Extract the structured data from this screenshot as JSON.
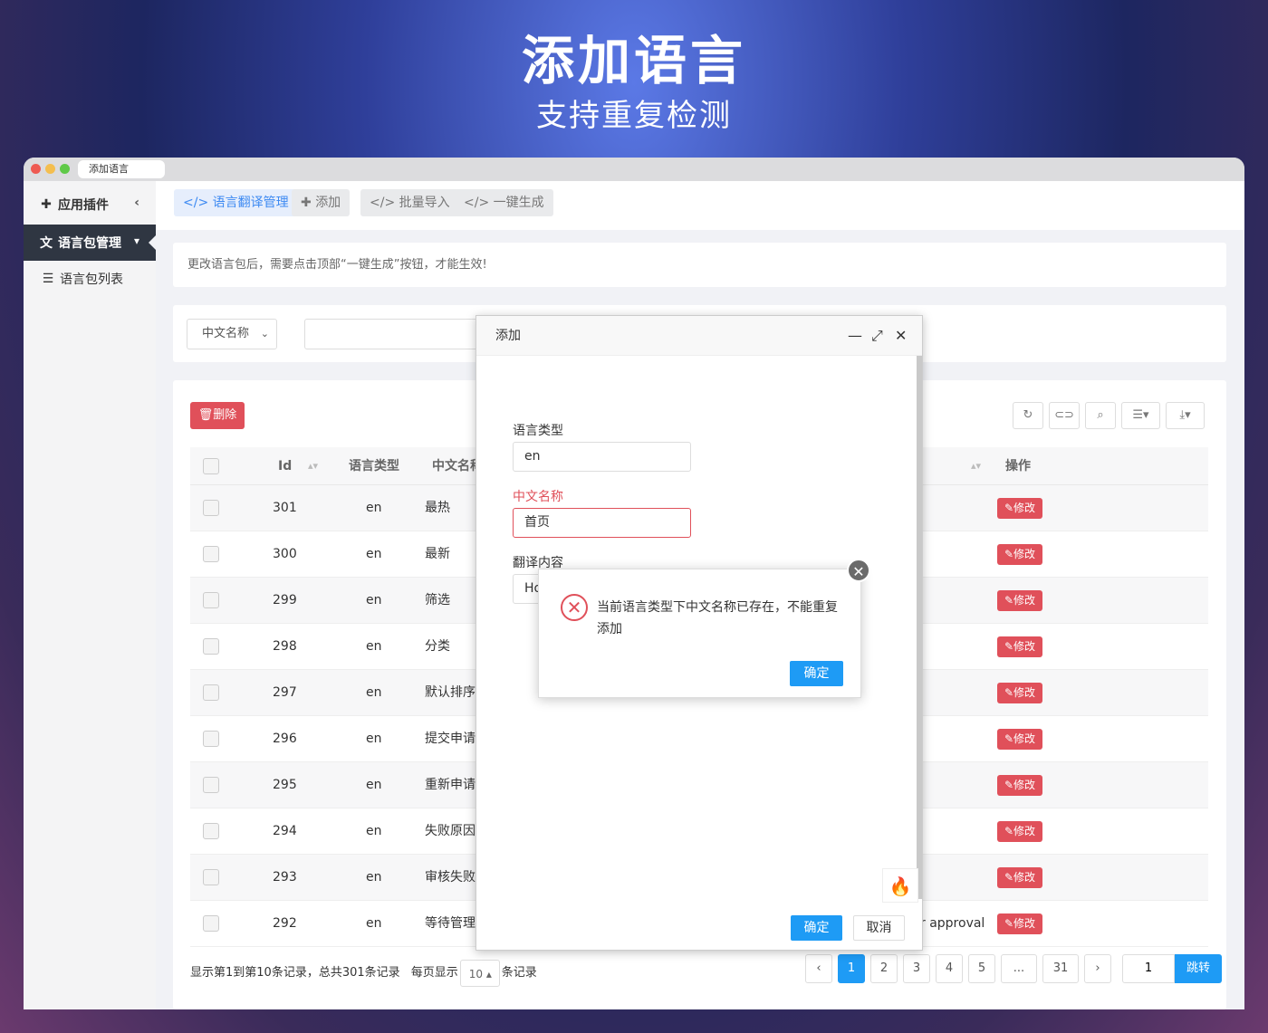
{
  "hero": {
    "title": "添加语言",
    "subtitle": "支持重复检测"
  },
  "window": {
    "tab_title": "添加语言"
  },
  "sidebar": {
    "plugin": "应用插件",
    "lang_manage": "语言包管理",
    "lang_list": "语言包列表"
  },
  "toolbar": {
    "translate_manage": "语言翻译管理",
    "add": "添加",
    "batch_import": "批量导入",
    "one_key": "一键生成"
  },
  "notice": "更改语言包后，需要点击顶部“一键生成”按钮，才能生效!",
  "filter": {
    "field_select": "中文名称"
  },
  "table": {
    "delete_label": "删除",
    "headers": {
      "id": "Id",
      "lang_type": "语言类型",
      "cn_name": "中文名称",
      "op": "操作"
    },
    "edit_label": "修改",
    "rows": [
      {
        "id": "301",
        "type": "en",
        "name": "最热",
        "extra": ""
      },
      {
        "id": "300",
        "type": "en",
        "name": "最新",
        "extra": ""
      },
      {
        "id": "299",
        "type": "en",
        "name": "筛选",
        "extra": ""
      },
      {
        "id": "298",
        "type": "en",
        "name": "分类",
        "extra": ""
      },
      {
        "id": "297",
        "type": "en",
        "name": "默认排序",
        "extra": ""
      },
      {
        "id": "296",
        "type": "en",
        "name": "提交申请",
        "extra": ""
      },
      {
        "id": "295",
        "type": "en",
        "name": "重新申请",
        "extra": ""
      },
      {
        "id": "294",
        "type": "en",
        "name": "失败原因",
        "extra": ""
      },
      {
        "id": "293",
        "type": "en",
        "name": "审核失败",
        "extra": ""
      },
      {
        "id": "292",
        "type": "en",
        "name": "等待管理",
        "extra": "r approval"
      }
    ]
  },
  "footer": {
    "summary": "显示第1到第10条记录，总共301条记录",
    "per_page_prefix": "每页显示",
    "page_size": "10",
    "per_page_suffix": "条记录"
  },
  "pagination": {
    "prev": "‹",
    "pages": [
      "1",
      "2",
      "3",
      "4",
      "5"
    ],
    "ellipsis": "...",
    "last": "31",
    "next": "›",
    "jump_value": "1",
    "jump_label": "跳转"
  },
  "dialog": {
    "title": "添加",
    "lang_type_label": "语言类型",
    "lang_type_value": "en",
    "cn_name_label": "中文名称",
    "cn_name_value": "首页",
    "content_label": "翻译内容",
    "content_value": "Ho",
    "confirm": "确定",
    "cancel": "取消"
  },
  "alert": {
    "message": "当前语言类型下中文名称已存在，不能重复添加",
    "confirm": "确定"
  },
  "colors": {
    "accent": "#1e9bf5",
    "danger": "#e0505a",
    "sidebar_active": "#2f3642"
  }
}
